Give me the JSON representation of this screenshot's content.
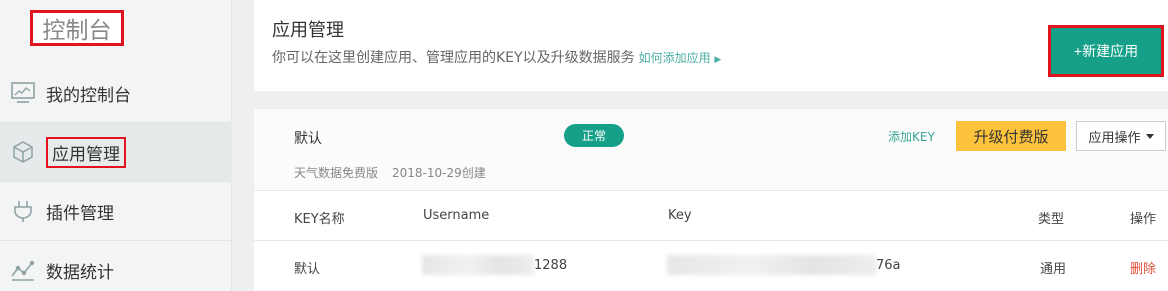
{
  "sidebar": {
    "title": "控制台",
    "items": [
      {
        "label": "我的控制台",
        "icon": "monitor-chart-icon"
      },
      {
        "label": "应用管理",
        "icon": "cube-icon"
      },
      {
        "label": "插件管理",
        "icon": "plug-icon"
      },
      {
        "label": "数据统计",
        "icon": "line-chart-icon"
      }
    ]
  },
  "header": {
    "title": "应用管理",
    "description": "你可以在这里创建应用、管理应用的KEY以及升级数据服务",
    "help_link": "如何添加应用",
    "new_app_button": "+新建应用"
  },
  "app": {
    "name": "默认",
    "status": "正常",
    "plan": "天气数据免费版",
    "created": "2018-10-29创建",
    "add_key": "添加KEY",
    "upgrade_button": "升级付费版",
    "ops_button": "应用操作"
  },
  "table": {
    "headers": [
      "KEY名称",
      "Username",
      "Key",
      "类型",
      "操作"
    ],
    "rows": [
      {
        "name": "默认",
        "username_visible": "1288",
        "key_visible": "76a",
        "type": "通用",
        "action": "删除"
      }
    ]
  },
  "colors": {
    "accent": "#17a089",
    "upgrade": "#fdc33c",
    "danger": "#e04e37",
    "highlight_border": "#e0141e"
  }
}
